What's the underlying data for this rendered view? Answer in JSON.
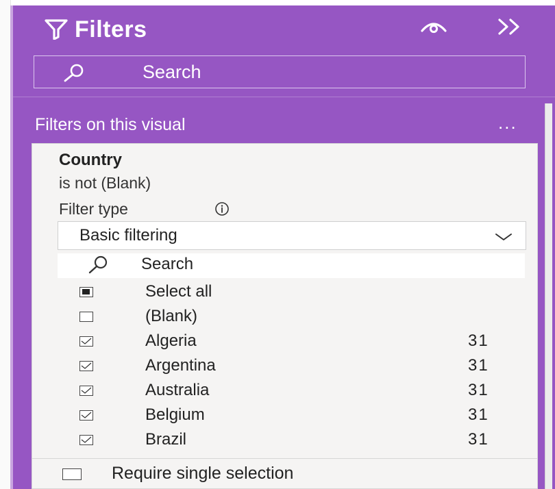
{
  "filters_pane": {
    "title": "Filters",
    "icons": {
      "funnel": "funnel-icon",
      "eye": "eye-icon",
      "collapse": "collapse-double-chevron-icon"
    },
    "search": {
      "placeholder": "Search",
      "icon": "search-icon"
    },
    "section_title": "Filters on this visual",
    "section_more": "...",
    "colors": {
      "pane_background": "#9656c3",
      "card_background": "#f5f4f3",
      "text_on_pane": "#ffffff"
    }
  },
  "filter_card": {
    "field_name": "Country",
    "condition": "is not (Blank)",
    "filter_type_label": "Filter type",
    "filter_type_info_icon": "info-icon",
    "filter_type_value": "Basic filtering",
    "dropdown_icon": "chevron-down-icon",
    "list_search_placeholder": "Search",
    "items": [
      {
        "label": "Select all",
        "count": "",
        "state": "partial"
      },
      {
        "label": "(Blank)",
        "count": "",
        "state": "unchecked"
      },
      {
        "label": "Algeria",
        "count": "31",
        "state": "checked"
      },
      {
        "label": "Argentina",
        "count": "31",
        "state": "checked"
      },
      {
        "label": "Australia",
        "count": "31",
        "state": "checked"
      },
      {
        "label": "Belgium",
        "count": "31",
        "state": "checked"
      },
      {
        "label": "Brazil",
        "count": "31",
        "state": "checked"
      }
    ],
    "require_single_selection": {
      "label": "Require single selection",
      "checked": false
    }
  }
}
